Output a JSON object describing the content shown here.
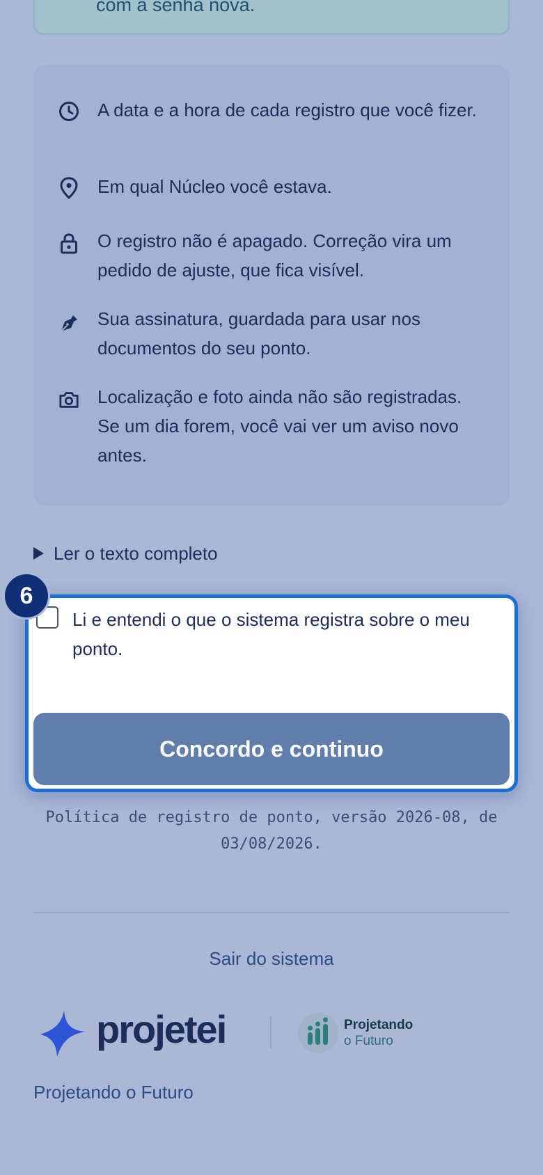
{
  "notice": {
    "text_fragment": "com a senha nova."
  },
  "info_items": [
    {
      "icon": "clock-icon",
      "text": "A data e a hora de cada registro que você fizer."
    },
    {
      "icon": "map-pin-icon",
      "text": "Em qual Núcleo você estava."
    },
    {
      "icon": "lock-icon",
      "text": "O registro não é apagado. Correção vira um pedido de ajuste, que fica visível."
    },
    {
      "icon": "pen-nib-icon",
      "text": "Sua assinatura, guardada para usar nos documentos do seu ponto."
    },
    {
      "icon": "camera-icon",
      "text": "Localização e foto ainda não são registradas. Se um dia forem, você vai ver um aviso novo antes."
    }
  ],
  "details": {
    "toggle_label": "Ler o texto completo"
  },
  "consent": {
    "step_number": "6",
    "checkbox_label": "Li e entendi o que o sistema registra sobre o meu ponto.",
    "checked": false,
    "button_label": "Concordo e continuo"
  },
  "policy_note": "Política de registro de ponto, versão 2026-08, de 03/08/2026.",
  "logout_label": "Sair do sistema",
  "brand": {
    "name": "projetei",
    "partner_title": "Projetando",
    "partner_subtitle": "o Futuro",
    "tagline": "Projetando o Futuro"
  },
  "colors": {
    "background": "#aab8d6",
    "card": "#a2b2d2",
    "accent_border": "#1c6fd4",
    "button": "#607dab",
    "text": "#1b2d5a"
  }
}
